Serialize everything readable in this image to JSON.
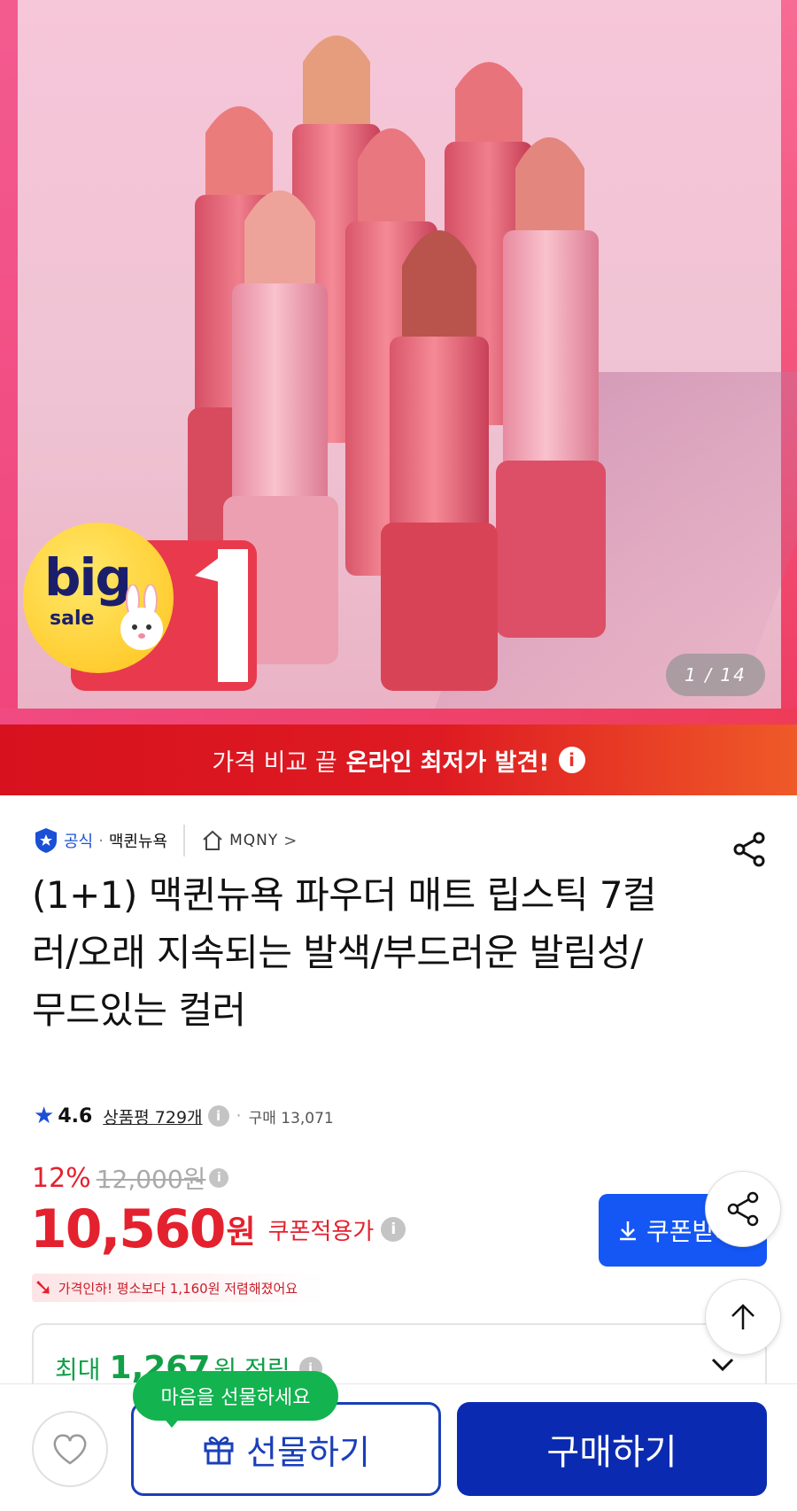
{
  "hero": {
    "counter": "1 / 14",
    "badge_big": "big",
    "badge_sale": "sale",
    "badge_one": "1"
  },
  "promo": {
    "light": "가격 비교 끝",
    "bold": "온라인 최저가 발견!",
    "info": "i"
  },
  "meta": {
    "official": "공식",
    "dot": "·",
    "brand": "맥퀸뉴욕",
    "store": "MQNY",
    "chev": ">"
  },
  "title": "(1+1) 맥퀸뉴욕 파우더 매트 립스틱 7컬러/오래 지속되는 발색/부드러운 발림성/무드있는 컬러",
  "rating": {
    "score": "4.6",
    "reviews": "상품평 729개",
    "info": "i",
    "dot": "·",
    "sold": "구매 13,071"
  },
  "price": {
    "discount": "12%",
    "original": "12,000원",
    "info": "i",
    "current": "10,560",
    "won": "원",
    "coupon_label": "쿠폰적용가",
    "down_text": "가격인하! 평소보다 1,160원 저렴해졌어요"
  },
  "coupon_button": {
    "label": "쿠폰받기"
  },
  "reward": {
    "prefix": "최대",
    "amount": "1,267",
    "unit": "원 적립",
    "info": "i"
  },
  "bottom": {
    "bubble": "마음을 선물하세요",
    "gift": "선물하기",
    "buy": "구매하기"
  },
  "colors": {
    "accent_red": "#e4212e",
    "brand_blue": "#1557f5",
    "buy_blue": "#0a2bb1",
    "reward_green": "#11a046"
  }
}
